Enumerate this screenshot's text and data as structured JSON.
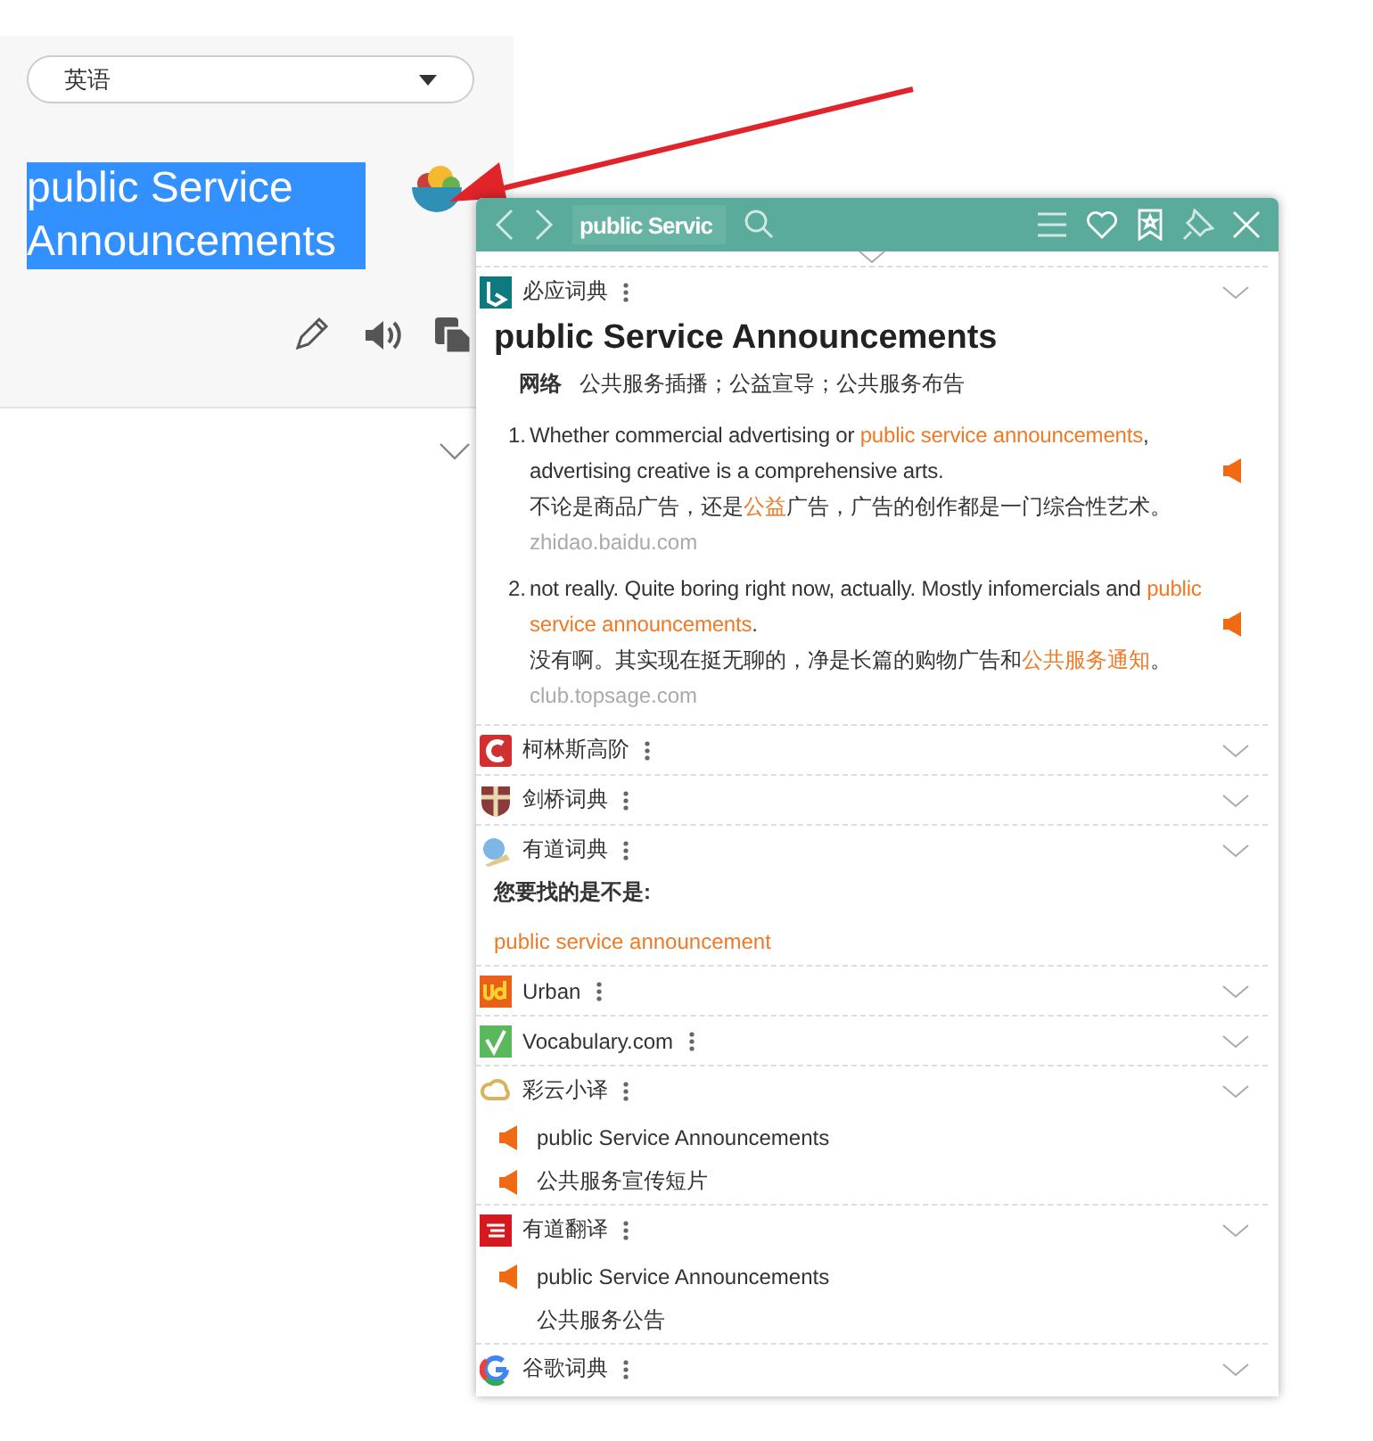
{
  "translator": {
    "language_select": {
      "value": "英语"
    },
    "source_text": "public Service Announcements",
    "source_selected": true
  },
  "popup": {
    "search_value": "public Servic",
    "sections": [
      {
        "kind": "dictionary",
        "name": "必应词典",
        "headword": "public Service Announcements",
        "definitions": [
          {
            "pos": "网络",
            "text": "公共服务插播；公益宣导；公共服务布告"
          }
        ],
        "examples": [
          {
            "number": "1.",
            "en": [
              {
                "text": "Whether commercial advertising or ",
                "highlight": false
              },
              {
                "text": "public service announcements",
                "highlight": true
              },
              {
                "text": ", advertising creative is a comprehensive arts.",
                "highlight": false
              }
            ],
            "zh": [
              {
                "text": "不论是商品广告，还是",
                "highlight": false
              },
              {
                "text": "公益",
                "highlight": true
              },
              {
                "text": "广告，广告的创作都是一门综合性艺术。",
                "highlight": false
              }
            ],
            "source": "zhidao.baidu.com"
          },
          {
            "number": "2.",
            "en": [
              {
                "text": "not really. Quite boring right now, actually. Mostly infomercials and ",
                "highlight": false
              },
              {
                "text": "public service announcements",
                "highlight": true
              },
              {
                "text": ".",
                "highlight": false
              }
            ],
            "zh": [
              {
                "text": "没有啊。其实现在挺无聊的，净是长篇的购物广告和",
                "highlight": false
              },
              {
                "text": "公共服务通知",
                "highlight": true
              },
              {
                "text": "。",
                "highlight": false
              }
            ],
            "source": "club.topsage.com"
          }
        ]
      },
      {
        "kind": "collapsed",
        "name": "柯林斯高阶"
      },
      {
        "kind": "collapsed",
        "name": "剑桥词典"
      },
      {
        "kind": "suggestion",
        "name": "有道词典",
        "prompt": "您要找的是不是:",
        "suggestion": "public service announcement"
      },
      {
        "kind": "collapsed",
        "name": "Urban"
      },
      {
        "kind": "collapsed",
        "name": "Vocabulary.com"
      },
      {
        "kind": "translation",
        "name": "彩云小译",
        "lines": [
          {
            "text": "public Service Announcements",
            "audio": true
          },
          {
            "text": "公共服务宣传短片",
            "audio": true
          }
        ]
      },
      {
        "kind": "translation",
        "name": "有道翻译",
        "lines": [
          {
            "text": "public Service Announcements",
            "audio": true
          },
          {
            "text": "公共服务公告",
            "audio": false
          }
        ]
      },
      {
        "kind": "collapsed",
        "name": "谷歌词典"
      }
    ]
  }
}
